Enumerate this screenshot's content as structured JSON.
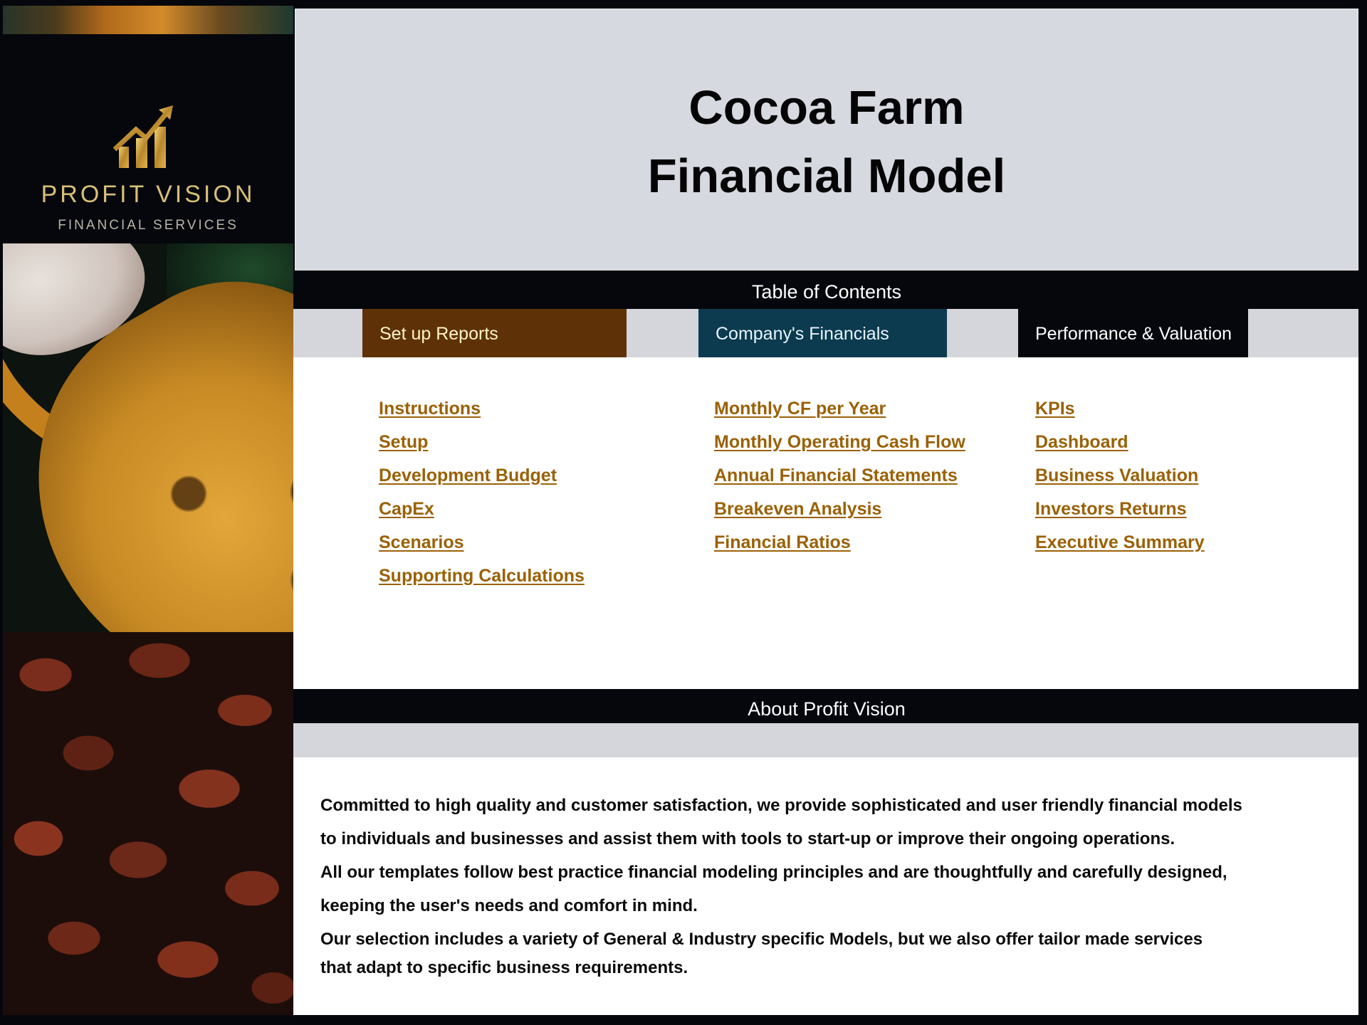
{
  "brand": {
    "name": "PROFIT VISION",
    "tagline": "FINANCIAL SERVICES",
    "logo_icon": "rising-bar-chart-arrow-icon",
    "gold": "#d9bf78"
  },
  "header": {
    "title_line1": "Cocoa Farm",
    "title_line2": "Financial Model"
  },
  "toc": {
    "heading": "Table of Contents",
    "sections": [
      {
        "label": "Set up Reports",
        "color": "#5e3206",
        "links": [
          "Instructions",
          "Setup",
          "Development Budget",
          "CapEx",
          "Scenarios",
          "Supporting Calculations"
        ]
      },
      {
        "label": "Company's Financials",
        "color": "#0c3a4f",
        "links": [
          "Monthly CF per Year",
          "Monthly Operating Cash Flow",
          "Annual Financial Statements",
          "Breakeven Analysis",
          "Financial Ratios"
        ]
      },
      {
        "label": "Performance & Valuation",
        "color": "#05070d",
        "links": [
          "KPIs",
          "Dashboard",
          "Business Valuation",
          "Investors Returns",
          "Executive Summary"
        ]
      }
    ],
    "link_color": "#9a6106"
  },
  "about": {
    "heading": "About Profit Vision",
    "lines": [
      "Committed to high quality and customer satisfaction, we provide sophisticated and user friendly financial models",
      "to individuals and businesses and assist them  with tools to start-up or improve their ongoing operations.",
      "All our templates follow best practice financial modeling principles and are thoughtfully and carefully designed,",
      "keeping the user's needs and comfort in mind.",
      "Our selection includes a variety of General & Industry specific Models, but we also offer tailor made services",
      "that adapt to specific business requirements."
    ]
  }
}
